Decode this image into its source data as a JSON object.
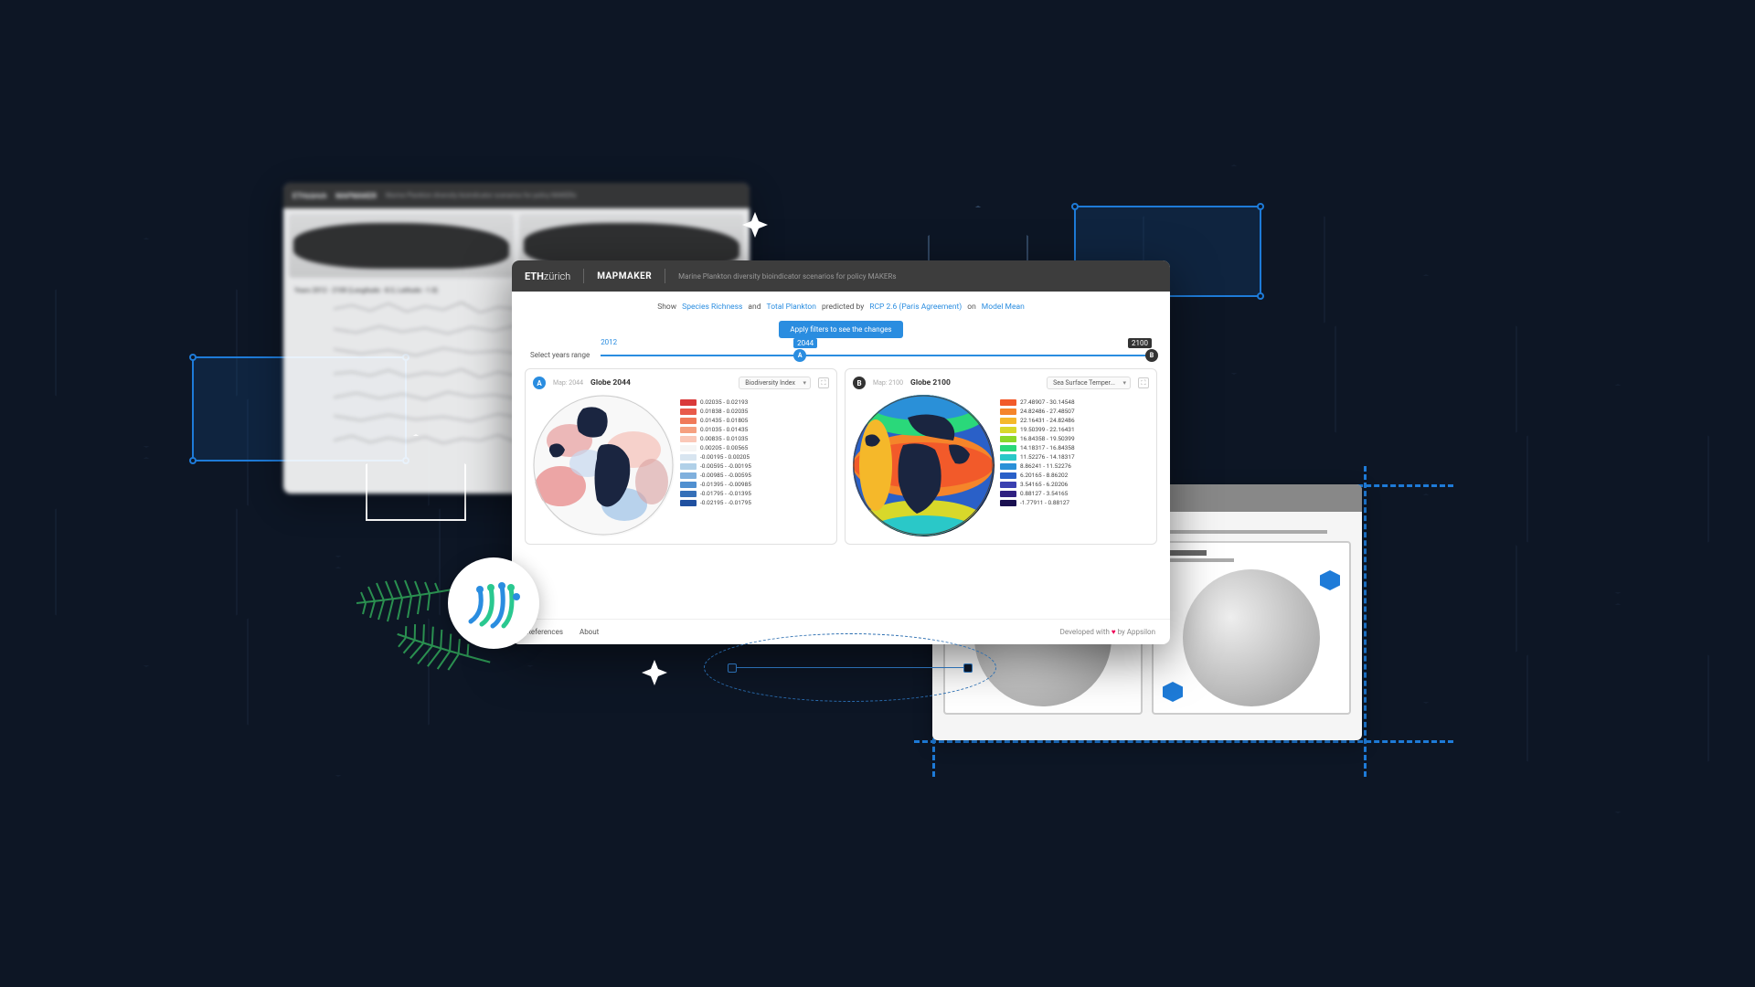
{
  "back_window": {
    "brand": "ETHzürich",
    "app": "MAPMAKER",
    "sub": "Marine Plankton diversity bioindicator scenarios for policy MAKERs",
    "chart_title": "Years 2012 - 2100 (Longitude: -8.5, Latitude: -1.8)"
  },
  "main": {
    "brand_a": "ETH",
    "brand_b": "zürich",
    "app": "MAPMAKER",
    "sub": "Marine Plankton diversity bioindicator scenarios for policy MAKERs",
    "filter": {
      "show": "Show",
      "metric1": "Species Richness",
      "and": "and",
      "metric2": "Total Plankton",
      "predicted": "predicted by",
      "rcp": "RCP 2.6 (Paris Agreement)",
      "on": "on",
      "model": "Model Mean"
    },
    "apply": "Apply filters to see the changes",
    "slider": {
      "label": "Select years range",
      "start": "2012",
      "mid": "2044",
      "end": "2100"
    },
    "panelA": {
      "badge": "A",
      "crumb": "Map: 2044",
      "title": "Globe 2044",
      "dropdown": "Biodiversity Index",
      "legend": [
        {
          "c": "#d93a3a",
          "t": "0.02035 - 0.02193"
        },
        {
          "c": "#e85a4a",
          "t": "0.01838 - 0.02035"
        },
        {
          "c": "#f07a5a",
          "t": "0.01435 - 0.01805"
        },
        {
          "c": "#f5a080",
          "t": "0.01035 - 0.01435"
        },
        {
          "c": "#fac8b8",
          "t": "0.00835 - 0.01035"
        },
        {
          "c": "#f5f5f5",
          "t": "0.00205 - 0.00565"
        },
        {
          "c": "#d8e5f0",
          "t": "-0.00195 - 0.00205"
        },
        {
          "c": "#b0d0e8",
          "t": "-0.00595 - -0.00195"
        },
        {
          "c": "#80b0dd",
          "t": "-0.00985 - -0.00595"
        },
        {
          "c": "#5090d0",
          "t": "-0.01395 - -0.00985"
        },
        {
          "c": "#3570b8",
          "t": "-0.01795 - -0.01395"
        },
        {
          "c": "#2050a0",
          "t": "-0.02195 - -0.01795"
        }
      ]
    },
    "panelB": {
      "badge": "B",
      "crumb": "Map: 2100",
      "title": "Globe 2100",
      "dropdown": "Sea Surface Temper...",
      "legend": [
        {
          "c": "#f25a2a",
          "t": "27.48907 - 30.14548"
        },
        {
          "c": "#f5852a",
          "t": "24.82486 - 27.48507"
        },
        {
          "c": "#f5b82a",
          "t": "22.16431 - 24.82486"
        },
        {
          "c": "#d8d82a",
          "t": "19.50399 - 22.16431"
        },
        {
          "c": "#8ad82a",
          "t": "16.84358 - 19.50399"
        },
        {
          "c": "#2ad87a",
          "t": "14.18317 - 16.84358"
        },
        {
          "c": "#2ac8c8",
          "t": "11.52276 - 14.18317"
        },
        {
          "c": "#2a90d8",
          "t": "8.86241 - 11.52276"
        },
        {
          "c": "#2a60c8",
          "t": "6.20165 - 8.86202"
        },
        {
          "c": "#3a40b0",
          "t": "3.54165 - 6.20206"
        },
        {
          "c": "#302080",
          "t": "0.88127 - 3.54165"
        },
        {
          "c": "#1a1050",
          "t": "-1.77911 - 0.88127"
        }
      ]
    },
    "footer": {
      "ref": "References",
      "about": "About",
      "credit_a": "Developed with",
      "credit_b": "by Appsilon"
    }
  }
}
